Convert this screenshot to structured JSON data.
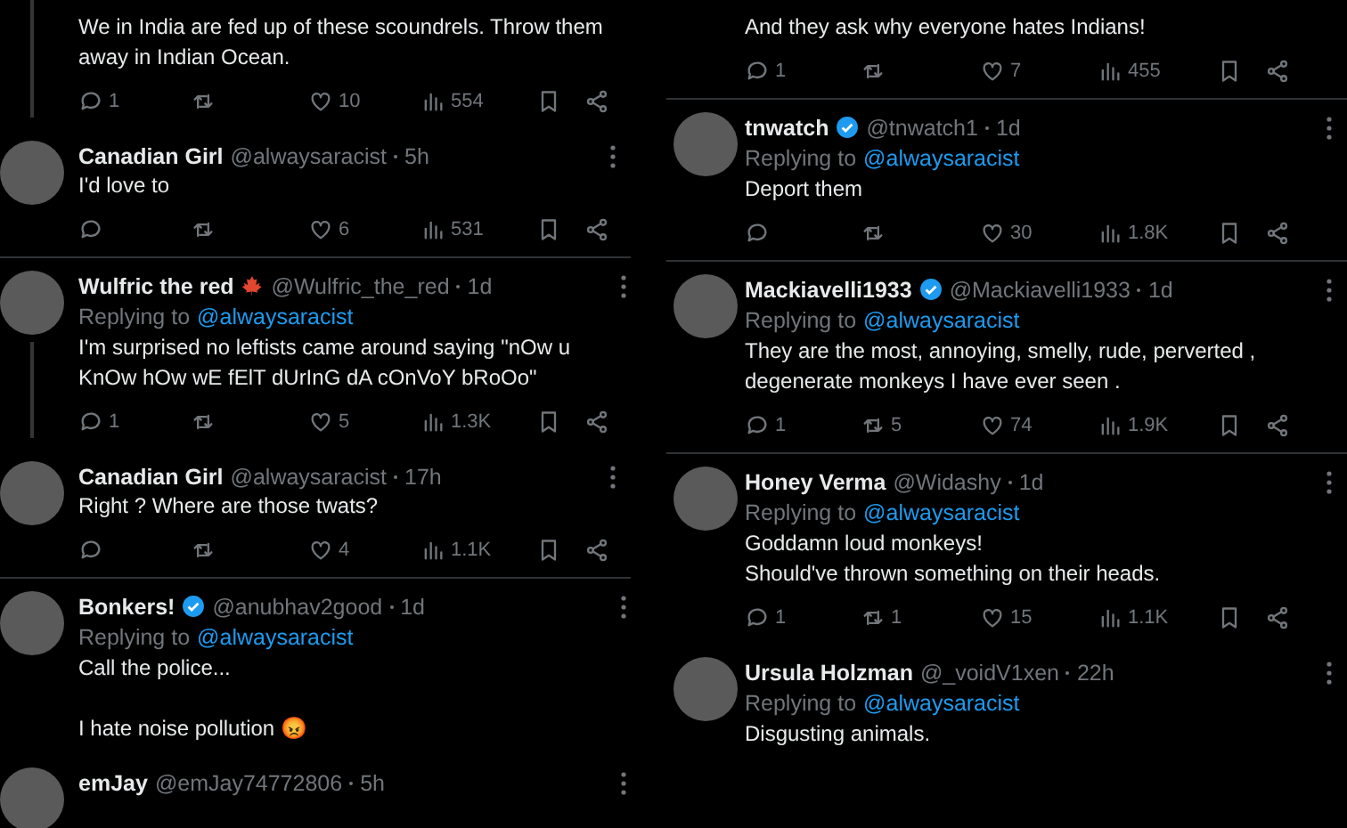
{
  "columns": [
    {
      "tweets": [
        {
          "thread_line": true,
          "separated": false,
          "text": "We in India are fed up of these scoundrels. Throw them away in Indian Ocean.",
          "stats": {
            "replies": "1",
            "likes": "10",
            "views": "554"
          }
        },
        {
          "name": "Canadian Girl",
          "handle": "@alwaysaracist",
          "time": "5h",
          "verified": false,
          "maple_leaf": false,
          "thread_line": false,
          "separated": true,
          "text": "I'd love to",
          "stats": {
            "likes": "6",
            "views": "531"
          }
        },
        {
          "name": "Wulfric the red",
          "handle": "@Wulfric_the_red",
          "time": "1d",
          "verified": false,
          "maple_leaf": true,
          "thread_line": true,
          "separated": false,
          "replying_label": "Replying to",
          "replying_to": "@alwaysaracist",
          "text": "I'm surprised no leftists came around saying \"nOw u KnOw hOw wE fElT dUrInG dA cOnVoY bRoOo\"",
          "stats": {
            "replies": "1",
            "likes": "5",
            "views": "1.3K"
          }
        },
        {
          "name": "Canadian Girl",
          "handle": "@alwaysaracist",
          "time": "17h",
          "verified": false,
          "maple_leaf": false,
          "thread_line": false,
          "separated": true,
          "text": "Right ? Where are those twats?",
          "stats": {
            "likes": "4",
            "views": "1.1K"
          }
        },
        {
          "name": "Bonkers!",
          "handle": "@anubhav2good",
          "time": "1d",
          "verified": true,
          "maple_leaf": false,
          "thread_line": false,
          "separated": false,
          "replying_label": "Replying to",
          "replying_to": "@alwaysaracist",
          "text": "Call the police...\n\nI hate noise pollution 😡"
        },
        {
          "name": "emJay",
          "handle": "@emJay74772806",
          "time": "5h",
          "verified": false,
          "maple_leaf": false
        }
      ]
    },
    {
      "tweets": [
        {
          "thread_line": false,
          "separated": true,
          "text": "And they ask why everyone hates Indians!",
          "stats": {
            "replies": "1",
            "likes": "7",
            "views": "455"
          }
        },
        {
          "name": "tnwatch",
          "handle": "@tnwatch1",
          "time": "1d",
          "verified": true,
          "maple_leaf": false,
          "thread_line": false,
          "separated": true,
          "replying_label": "Replying to",
          "replying_to": "@alwaysaracist",
          "text": "Deport them",
          "stats": {
            "likes": "30",
            "views": "1.8K"
          }
        },
        {
          "name": "Mackiavelli1933",
          "handle": "@Mackiavelli1933",
          "time": "1d",
          "verified": true,
          "maple_leaf": false,
          "thread_line": false,
          "separated": true,
          "replying_label": "Replying to",
          "replying_to": "@alwaysaracist",
          "text": "They are the most, annoying, smelly, rude, perverted , degenerate monkeys I have ever seen .",
          "stats": {
            "replies": "1",
            "reposts": "5",
            "likes": "74",
            "views": "1.9K"
          }
        },
        {
          "name": "Honey Verma",
          "handle": "@Widashy",
          "time": "1d",
          "verified": false,
          "maple_leaf": false,
          "thread_line": false,
          "separated": false,
          "replying_label": "Replying to",
          "replying_to": "@alwaysaracist",
          "text": "Goddamn loud monkeys!\nShould've thrown something on their heads.",
          "stats": {
            "replies": "1",
            "reposts": "1",
            "likes": "15",
            "views": "1.1K"
          }
        },
        {
          "name": "Ursula Holzman",
          "handle": "@_voidV1xen",
          "time": "22h",
          "verified": false,
          "maple_leaf": false,
          "thread_line": false,
          "separated": false,
          "replying_label": "Replying to",
          "replying_to": "@alwaysaracist",
          "text": "Disgusting animals."
        }
      ]
    }
  ]
}
